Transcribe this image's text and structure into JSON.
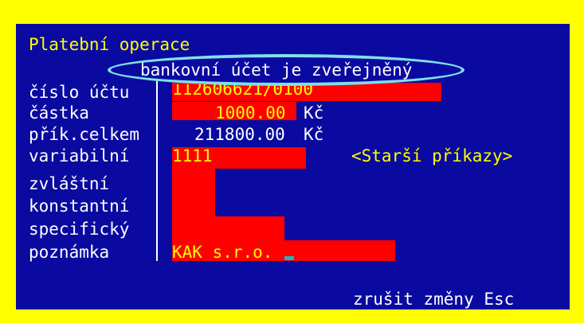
{
  "screen": {
    "title": "Platební operace",
    "account_status": "bankovní účet je zveřejněný",
    "fields": [
      {
        "label": "číslo účtu",
        "value": "112606621/0100"
      },
      {
        "label": "částka",
        "value": "1000.00",
        "unit": "Kč"
      },
      {
        "label": "přík.celkem",
        "value": "211800.00",
        "unit": "Kč"
      },
      {
        "label": "variabilní",
        "value": "1111"
      },
      {
        "label": "zvláštní",
        "value": ""
      },
      {
        "label": "konstantní",
        "value": ""
      },
      {
        "label": "specifický",
        "value": ""
      },
      {
        "label": "poznámka",
        "value": "KAK s.r.o."
      }
    ],
    "older_orders_button": "<Starší příkazy>",
    "cancel_hint": "zrušit změny Esc"
  },
  "colors": {
    "frame": "#ffff00",
    "screen_bg": "#0a0aa0",
    "field_bg": "#ff0000",
    "text": "#ffffff",
    "highlight_text": "#ffff00",
    "annotation_ellipse": "#7fe0ea",
    "cursor": "#20b2c8"
  }
}
